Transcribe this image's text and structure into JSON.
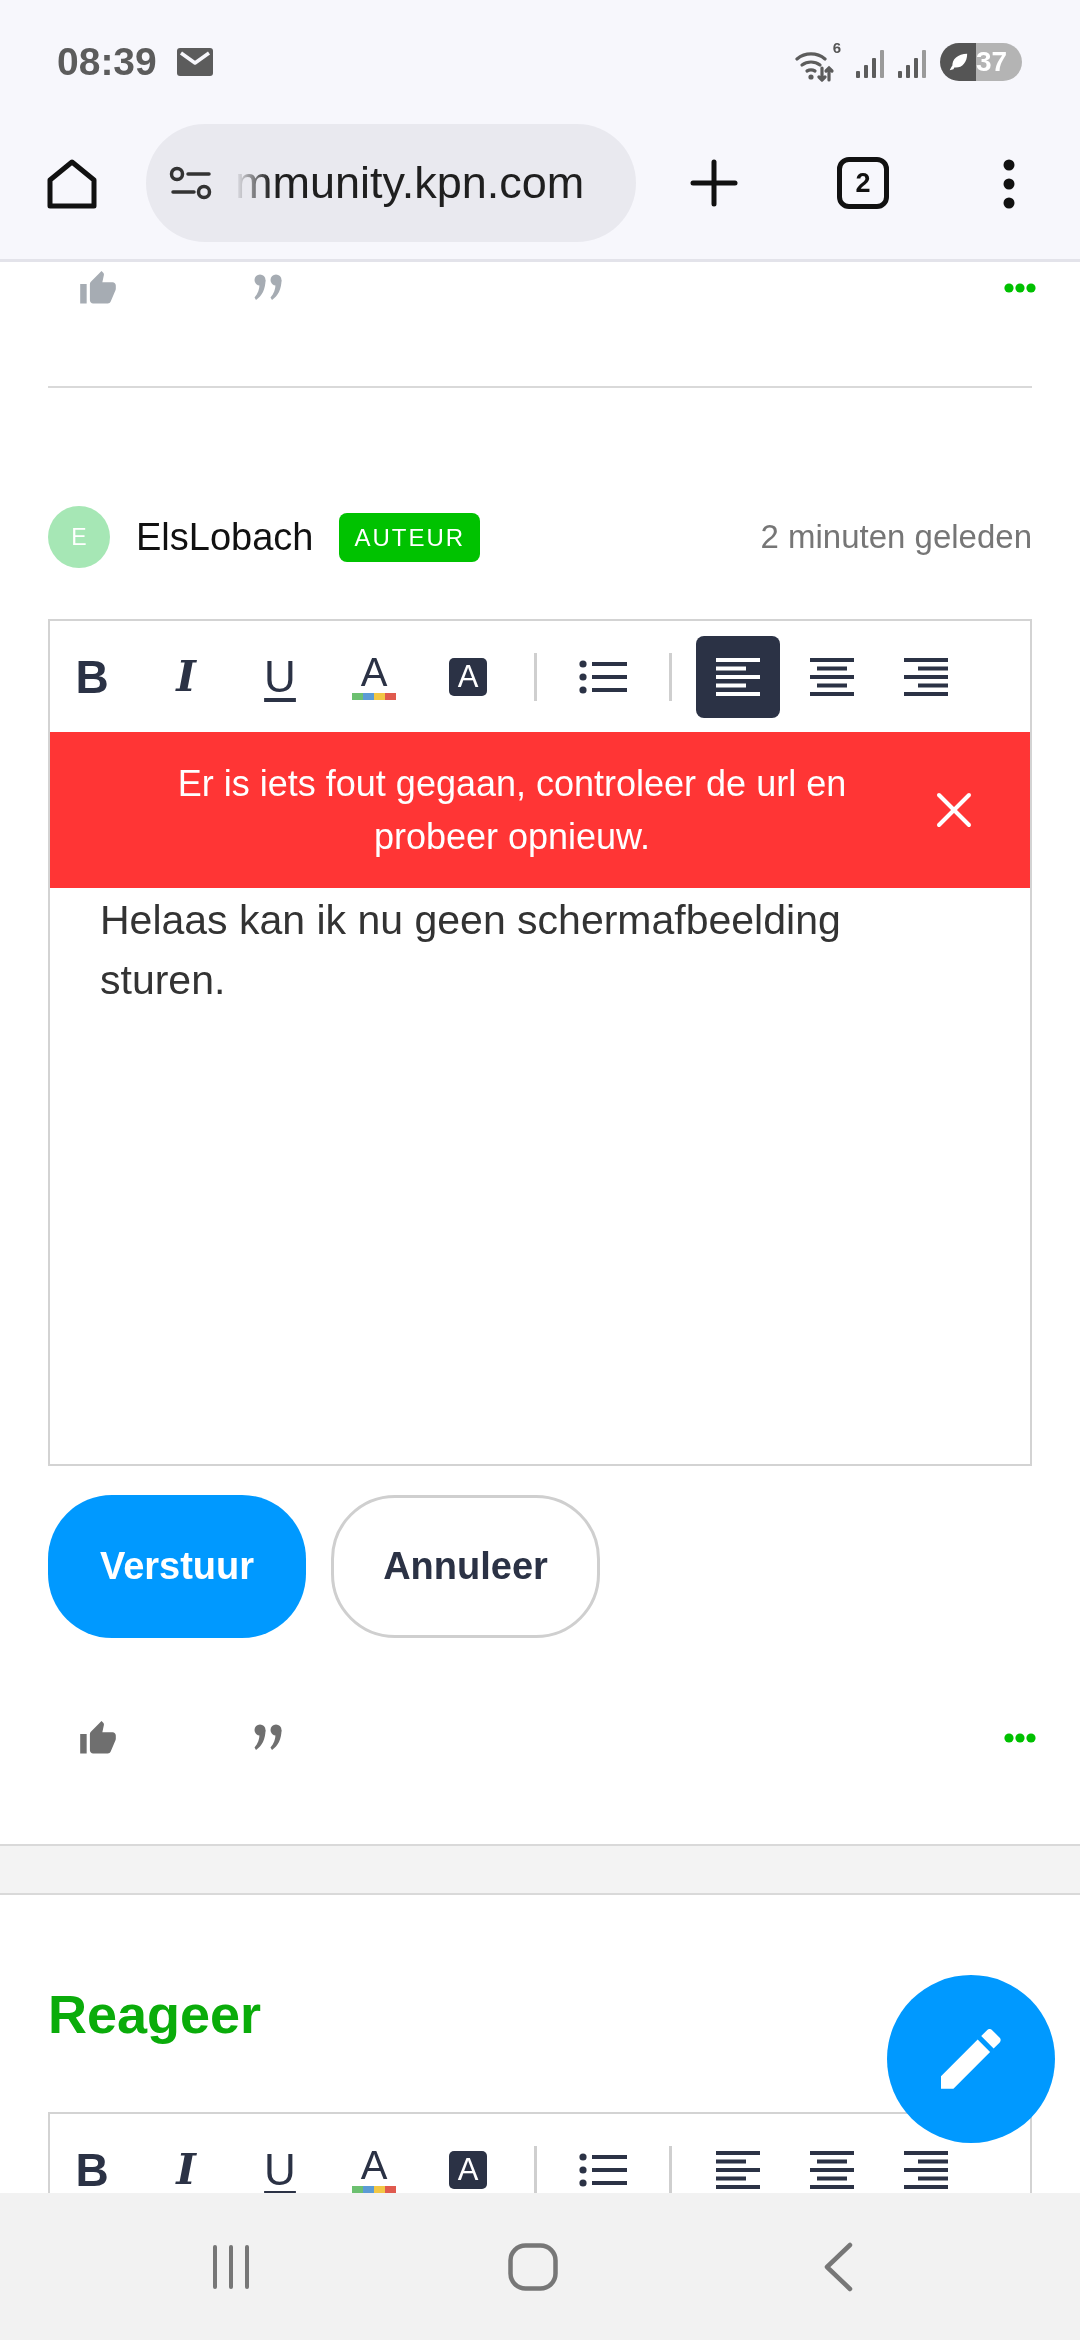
{
  "status_bar": {
    "time": "08:39",
    "wifi_label": "6",
    "battery": "37"
  },
  "browser": {
    "url": "mmunity.kpn.com",
    "tab_count": "2"
  },
  "top_actions": {
    "disabled": true
  },
  "comment": {
    "author": "ElsLobach",
    "avatar": "E",
    "badge": "AUTEUR",
    "time": "2 minuten geleden",
    "editor": {
      "tools": [
        {
          "kind": "bold",
          "label": "B",
          "selected": false
        },
        {
          "kind": "italic",
          "label": "I",
          "selected": false
        },
        {
          "kind": "underline",
          "label": "U",
          "selected": false
        },
        {
          "kind": "text_color",
          "label": "A",
          "selected": false
        },
        {
          "kind": "highlight",
          "label": "A",
          "selected": false
        },
        {
          "kind": "separator"
        },
        {
          "kind": "bullet_list",
          "selected": false
        },
        {
          "kind": "separator"
        },
        {
          "kind": "align_left",
          "selected": true
        },
        {
          "kind": "align_center",
          "selected": false
        },
        {
          "kind": "align_right",
          "selected": false
        }
      ],
      "error": "Er is iets fout gegaan, controleer de url en probeer opnieuw.",
      "text": "Helaas kan ik nu geen schermafbeelding sturen."
    },
    "buttons": [
      {
        "kind": "primary",
        "label": "Verstuur"
      },
      {
        "kind": "secondary",
        "label": "Annuleer"
      }
    ],
    "actions": {
      "disabled": false
    }
  },
  "reply": {
    "title": "Reageer",
    "editor": {
      "tools": [
        {
          "kind": "bold",
          "label": "B",
          "selected": false
        },
        {
          "kind": "italic",
          "label": "I",
          "selected": false
        },
        {
          "kind": "underline",
          "label": "U",
          "selected": false
        },
        {
          "kind": "text_color",
          "label": "A",
          "selected": false
        },
        {
          "kind": "highlight",
          "label": "A",
          "selected": false
        },
        {
          "kind": "separator"
        },
        {
          "kind": "bullet_list",
          "selected": false
        },
        {
          "kind": "separator"
        },
        {
          "kind": "align_left",
          "selected": false
        },
        {
          "kind": "align_center",
          "selected": false
        },
        {
          "kind": "align_right",
          "selected": false
        }
      ]
    }
  }
}
